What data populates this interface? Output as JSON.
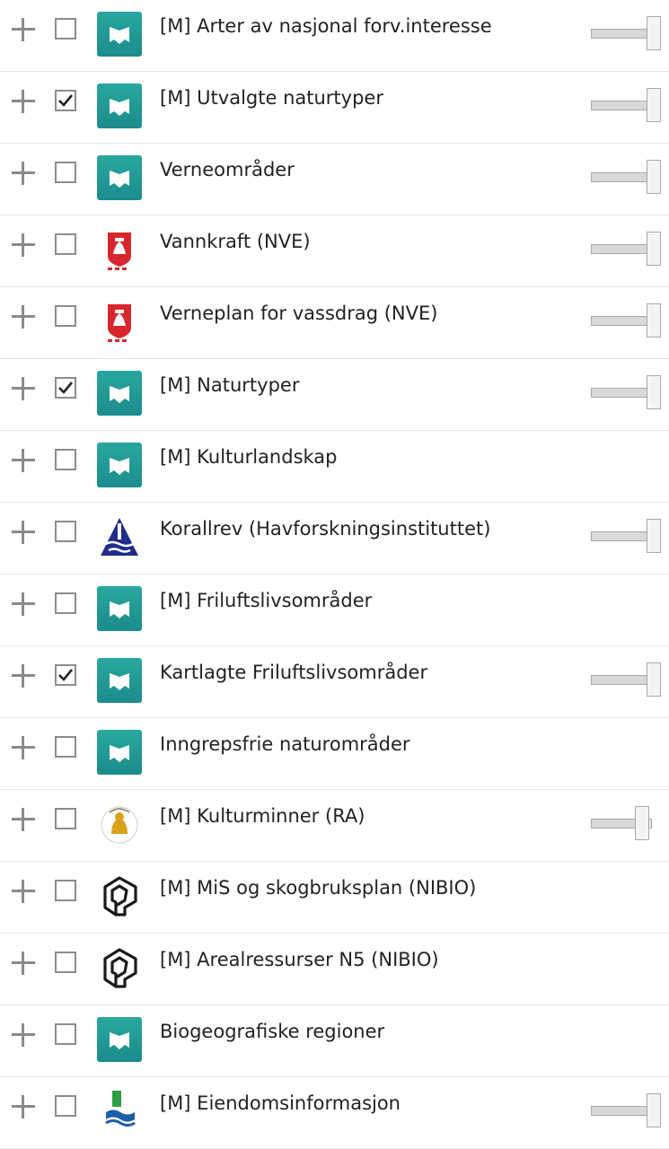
{
  "layers": [
    {
      "label": "[M] Arter av nasjonal forv.interesse",
      "checked": false,
      "icon": "miljodirektoratet-icon",
      "opacity": 1.0
    },
    {
      "label": "[M] Utvalgte naturtyper",
      "checked": true,
      "icon": "miljodirektoratet-icon",
      "opacity": 1.0
    },
    {
      "label": "Verneområder",
      "checked": false,
      "icon": "miljodirektoratet-icon",
      "opacity": 1.0
    },
    {
      "label": "Vannkraft (NVE)",
      "checked": false,
      "icon": "nve-icon",
      "opacity": 1.0
    },
    {
      "label": "Verneplan for vassdrag (NVE)",
      "checked": false,
      "icon": "nve-icon",
      "opacity": 1.0
    },
    {
      "label": "[M] Naturtyper",
      "checked": true,
      "icon": "miljodirektoratet-icon",
      "opacity": 1.0
    },
    {
      "label": "[M] Kulturlandskap",
      "checked": false,
      "icon": "miljodirektoratet-icon",
      "opacity": null
    },
    {
      "label": "Korallrev (Havforskningsinstituttet)",
      "checked": false,
      "icon": "havforskningsinstituttet-icon",
      "opacity": 1.0
    },
    {
      "label": "[M] Friluftslivsområder",
      "checked": false,
      "icon": "miljodirektoratet-icon",
      "opacity": null
    },
    {
      "label": "Kartlagte Friluftslivsområder",
      "checked": true,
      "icon": "miljodirektoratet-icon",
      "opacity": 1.0
    },
    {
      "label": "Inngrepsfrie naturområder",
      "checked": false,
      "icon": "miljodirektoratet-icon",
      "opacity": null
    },
    {
      "label": "[M] Kulturminner (RA)",
      "checked": false,
      "icon": "riksantikvaren-icon",
      "opacity": 0.8
    },
    {
      "label": "[M] MiS og skogbruksplan (NIBIO)",
      "checked": false,
      "icon": "nibio-icon",
      "opacity": null
    },
    {
      "label": "[M] Arealressurser N5 (NIBIO)",
      "checked": false,
      "icon": "nibio-icon",
      "opacity": null
    },
    {
      "label": "Biogeografiske regioner",
      "checked": false,
      "icon": "miljodirektoratet-icon",
      "opacity": null
    },
    {
      "label": "[M] Eiendomsinformasjon",
      "checked": false,
      "icon": "kartverket-icon",
      "opacity": 1.0
    }
  ],
  "colors": {
    "miljodirektoratet": "#1a8c8c",
    "nve": "#d8262e",
    "havforskningsinstituttet": "#1f2e8c",
    "riksantikvaren": "#d9a21a",
    "nibio": "#1a1a1a",
    "kartverket_green": "#2ea043",
    "kartverket_blue": "#1b5fa8"
  }
}
